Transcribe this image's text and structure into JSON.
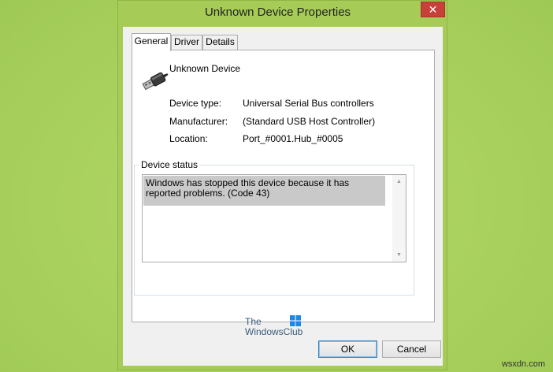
{
  "window": {
    "title": "Unknown Device Properties",
    "close_glyph": "✕"
  },
  "tabs": [
    {
      "label": "General",
      "active": true
    },
    {
      "label": "Driver",
      "active": false
    },
    {
      "label": "Details",
      "active": false
    }
  ],
  "general": {
    "device_name": "Unknown Device",
    "device_icon": "usb-plug-icon",
    "properties": [
      {
        "label": "Device type:",
        "value": "Universal Serial Bus controllers"
      },
      {
        "label": "Manufacturer:",
        "value": "(Standard USB Host Controller)"
      },
      {
        "label": "Location:",
        "value": "Port_#0001.Hub_#0005"
      }
    ],
    "status_group_title": "Device status",
    "status_text": "Windows has stopped this device because it has reported problems. (Code 43)"
  },
  "logo": {
    "line1": "The",
    "line2": "WindowsClub",
    "icon": "windows-flag-icon"
  },
  "buttons": {
    "ok_label": "OK",
    "cancel_label": "Cancel"
  },
  "watermark": "wsxdn.com",
  "colors": {
    "desktop": "#a9d15e",
    "window_frame": "#a6cc57",
    "close_button": "#c7413a",
    "selection": "#c9c9c9"
  }
}
